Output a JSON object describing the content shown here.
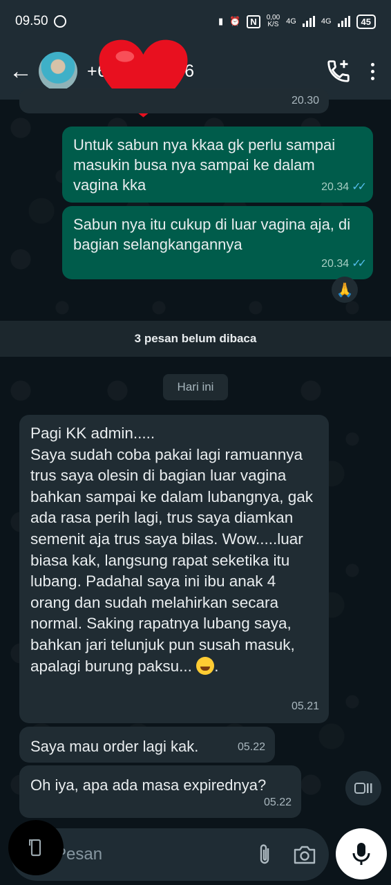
{
  "status_bar": {
    "time": "09.50",
    "net_speed": "0,00\nK/S",
    "net1": "4G",
    "net2": "4G",
    "battery": "45"
  },
  "header": {
    "contact_name": "+6        -6266"
  },
  "messages": {
    "m0_time": "20.30",
    "m1_text": "Untuk sabun nya kkaa gk perlu sampai masukin busa nya sampai ke dalam vagina kka",
    "m1_time": "20.34",
    "m2_text": "Sabun nya itu cukup di luar vagina aja, di bagian selangkangannya",
    "m2_time": "20.34",
    "reaction": "🙏",
    "unread_banner": "3 pesan belum dibaca",
    "date_chip": "Hari ini",
    "m3_text": "Pagi KK admin.....\nSaya sudah coba pakai lagi ramuannya trus saya olesin di bagian luar vagina bahkan sampai ke dalam lubangnya, gak ada rasa perih lagi, trus saya diamkan semenit aja trus saya bilas. Wow.....luar biasa kak, langsung rapat seketika itu lubang. Padahal saya ini ibu anak 4 orang dan sudah melahirkan secara normal. Saking rapatnya lubang saya, bahkan jari telunjuk pun susah masuk, apalagi burung paksu...",
    "m3_time": "05.21",
    "m4_text": "Saya mau order lagi kak.",
    "m4_time": "05.22",
    "m5_text": "Oh iya, apa ada masa expirednya?",
    "m5_time": "05.22"
  },
  "composer": {
    "placeholder": "Pesan"
  },
  "colors": {
    "outgoing_bubble": "#005c4b",
    "incoming_bubble": "#202c33",
    "read_ticks": "#53bdeb"
  }
}
